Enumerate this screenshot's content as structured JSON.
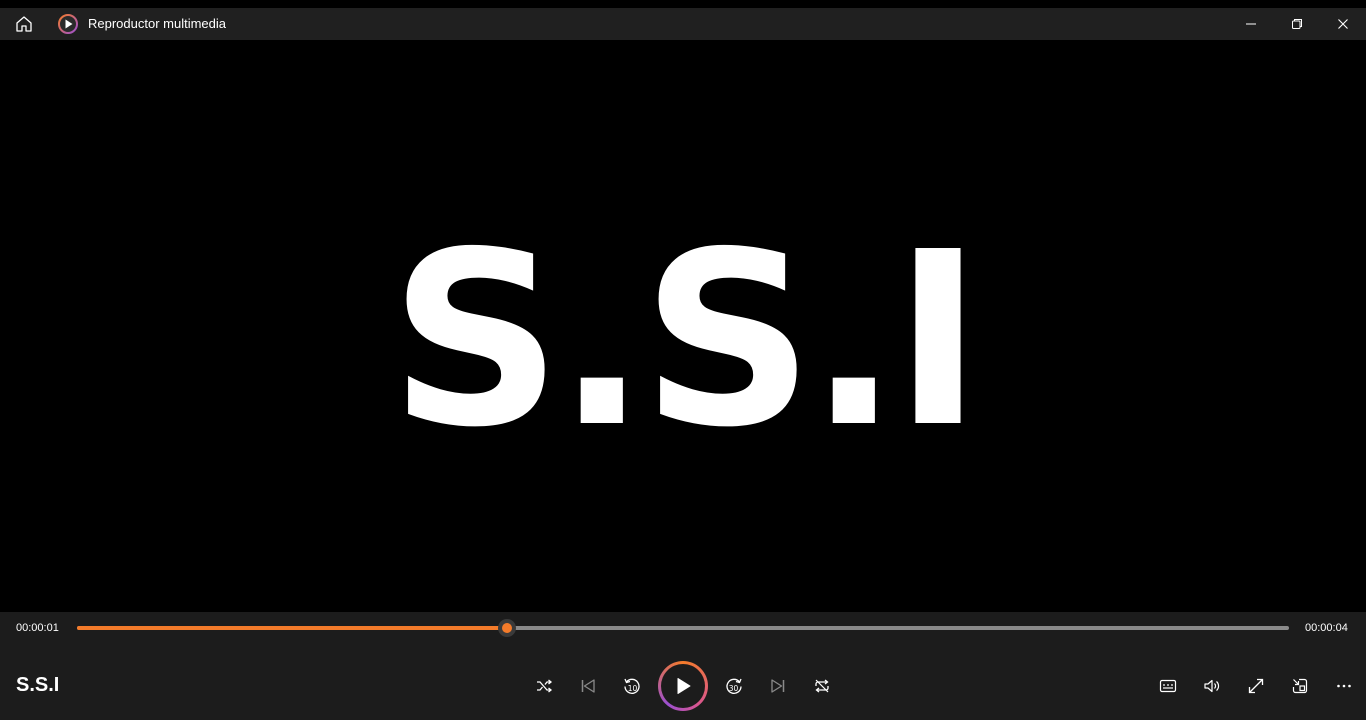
{
  "titlebar": {
    "title": "Reproductor multimedia"
  },
  "video": {
    "text": "S.S.I"
  },
  "playback": {
    "current_time": "00:00:01",
    "total_time": "00:00:04",
    "progress": 0.355
  },
  "media": {
    "title": "S.S.I"
  },
  "colors": {
    "accent": "#f47b2a",
    "titlebar_bg": "#202020",
    "controls_bg": "#1c1c1c",
    "track": "#8a8a8a"
  },
  "icons": {
    "home": "home-icon",
    "app": "media-player-app-icon",
    "minimize": "minimize-icon",
    "maximize": "restore-icon",
    "close": "close-icon",
    "shuffle": "shuffle-icon",
    "previous": "previous-icon",
    "rewind": "rewind-10-icon",
    "play": "play-icon",
    "forward": "forward-30-icon",
    "next": "next-icon",
    "repeat": "repeat-icon",
    "captions": "captions-icon",
    "volume": "volume-icon",
    "fullscreen": "fullscreen-icon",
    "miniplayer": "miniplayer-icon",
    "more": "more-icon"
  }
}
